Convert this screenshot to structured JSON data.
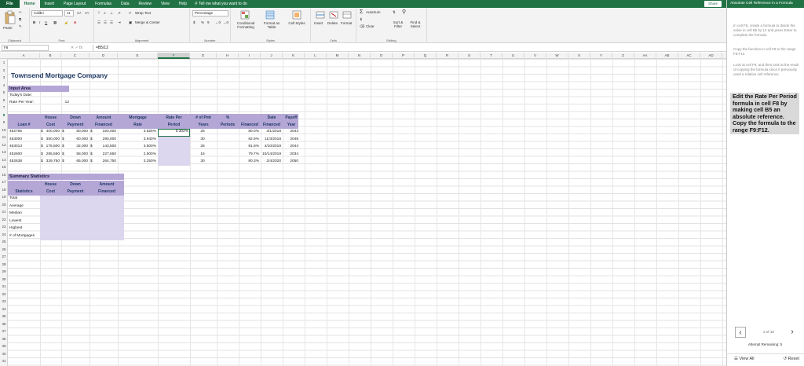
{
  "tabs": [
    "File",
    "Home",
    "Insert",
    "Page Layout",
    "Formulas",
    "Data",
    "Review",
    "View",
    "Help"
  ],
  "tell_me": "Tell me what you want to do",
  "share": "Share",
  "ribbon": {
    "paste": "Paste",
    "clipboard": "Clipboard",
    "font_name": "Calibri",
    "font_size": "11",
    "bold": "B",
    "italic": "I",
    "underline": "U",
    "font_group": "Font",
    "wrap_text": "Wrap Text",
    "merge_center": "Merge & Center",
    "alignment_group": "Alignment",
    "number_format": "Percentage",
    "currency": "$",
    "percent": "%",
    "comma": "9",
    "number_group": "Number",
    "conditional_formatting": "Conditional Formatting",
    "format_as_table": "Format as Table",
    "cell_styles": "Cell Styles",
    "styles_group": "Styles",
    "insert": "Insert",
    "delete": "Delete",
    "format": "Format",
    "cells_group": "Cells",
    "autosum": "AutoSum",
    "clear": "Clear",
    "sort_filter": "Sort & Filter",
    "find_select": "Find & Select",
    "editing_group": "Editing"
  },
  "formula_bar": {
    "name_box": "F8",
    "buttons": "✕  ✓  fx",
    "formula": "=B5/12"
  },
  "columns": [
    "A",
    "B",
    "C",
    "D",
    "E",
    "F",
    "G",
    "H",
    "I",
    "J",
    "K",
    "L",
    "M",
    "N",
    "O",
    "P",
    "Q",
    "R",
    "S",
    "T",
    "U",
    "V",
    "W",
    "X",
    "Y",
    "Z",
    "AA",
    "AB",
    "AC",
    "AD",
    "AE"
  ],
  "rows": [
    "1",
    "2",
    "3",
    "4",
    "5",
    "6",
    "7",
    "8",
    "9",
    "10",
    "11",
    "12",
    "13",
    "14",
    "15",
    "16",
    "17",
    "18",
    "19",
    "20",
    "21",
    "22",
    "23",
    "24",
    "25",
    "26",
    "27",
    "28",
    "29",
    "30",
    "31",
    "32",
    "33",
    "34",
    "35",
    "36",
    "37",
    "38",
    "39",
    "40",
    "41"
  ],
  "sheet": {
    "title": "Townsend Mortgage Company",
    "input_area": "Input Area",
    "todays_date": "Today's Date:",
    "rate_per_year_label": "Rate Per Year:",
    "rate_per_year_value": "12",
    "headers_row1": [
      "",
      "House",
      "Down",
      "Amount",
      "Mortgage",
      "Rate Per",
      "# of Pmt",
      "%",
      "Date",
      "Payoff"
    ],
    "headers_row2": [
      "Loan #",
      "Cost",
      "Payment",
      "Financed",
      "Rate",
      "Period",
      "Years",
      "Periods",
      "Financed",
      "Financed",
      "Year"
    ],
    "loans": [
      {
        "loan": "452786",
        "cost": "400,000",
        "down": "80,000",
        "financed": "320,000",
        "rate": "3.625%",
        "period": "0.302%",
        "years": "25",
        "pct": "80.0%",
        "date": "3/1/2018",
        "payoff": "2043"
      },
      {
        "loan": "453000",
        "cost": "350,000",
        "down": "60,000",
        "financed": "290,000",
        "rate": "3.940%",
        "period": "",
        "years": "30",
        "pct": "82.9%",
        "date": "11/3/2018",
        "payoff": "2048"
      },
      {
        "loan": "453013",
        "cost": "175,500",
        "down": "32,000",
        "financed": "143,500",
        "rate": "3.500%",
        "period": "",
        "years": "25",
        "pct": "81.8%",
        "date": "4/10/2019",
        "payoff": "2044"
      },
      {
        "loan": "452600",
        "cost": "285,550",
        "down": "58,000",
        "financed": "227,550",
        "rate": "2.500%",
        "period": "",
        "years": "15",
        "pct": "79.7%",
        "date": "10/14/2019",
        "payoff": "2034"
      },
      {
        "loan": "452638",
        "cost": "329,750",
        "down": "65,000",
        "financed": "264,750",
        "rate": "3.250%",
        "period": "",
        "years": "30",
        "pct": "80.3%",
        "date": "2/4/2020",
        "payoff": "2050"
      }
    ],
    "summary_title": "Summary Statistics",
    "summary_headers_row1": [
      "",
      "House",
      "Down",
      "Amount"
    ],
    "summary_headers_row2": [
      "Statistics",
      "Cost",
      "Payment",
      "Financed"
    ],
    "summary_rows": [
      "Total",
      "Average",
      "Median",
      "Lowest",
      "Highest",
      "# of Mortgages"
    ]
  },
  "pane": {
    "title": "Absolute Cell Reference in a Formula",
    "p1": "In cell F8, create a formula to divide the value in cell B5 by 12 and press Enter to complete the formula.",
    "p2": "Copy the function in cell F8 to the range F9:F12.",
    "p3": "Look at cell F9, and then look at the result of copying the formula since it previously used a relative cell reference.",
    "instruction": "Edit the Rate Per Period formula in cell F8 by making cell B5 an absolute reference. Copy the formula to the range F9:F12.",
    "pager": "2 of 10",
    "points": "Attempt Remaining: 5",
    "view_all": "View All",
    "reset": "Reset"
  }
}
